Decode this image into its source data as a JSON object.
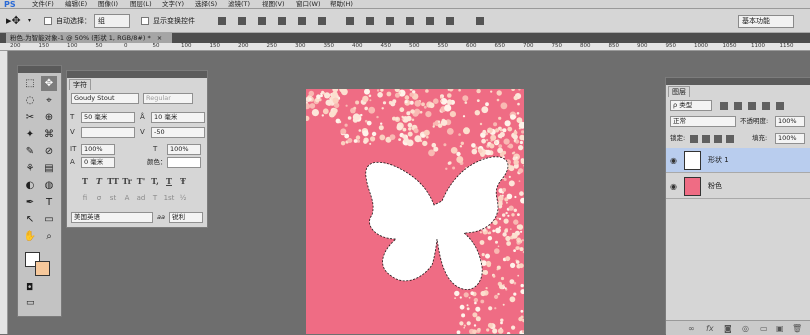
{
  "app": {
    "logo": "PS"
  },
  "menu": [
    "文件(F)",
    "编辑(E)",
    "图像(I)",
    "图层(L)",
    "文字(Y)",
    "选择(S)",
    "滤镜(T)",
    "视图(V)",
    "窗口(W)",
    "帮助(H)"
  ],
  "options": {
    "auto_select_label": "自动选择：",
    "auto_select_value": "组",
    "show_transform_label": "显示变换控件",
    "workspace": "基本功能"
  },
  "document": {
    "tab": "粉色.为智能对象-1 @ 50% (形状 1, RGB/8#) *",
    "close": "×"
  },
  "ruler": [
    "200",
    "150",
    "100",
    "50",
    "0",
    "50",
    "100",
    "150",
    "200",
    "250",
    "300",
    "350",
    "400",
    "450",
    "500",
    "550",
    "600",
    "650",
    "700",
    "750",
    "800",
    "850",
    "900",
    "950",
    "1000",
    "1050",
    "1100",
    "1150"
  ],
  "tools": {
    "icons": [
      "⬚",
      "✥",
      "◌",
      "⌖",
      "✂",
      "⊕",
      "✦",
      "⌘",
      "✎",
      "⊘",
      "⚘",
      "▤",
      "◐",
      "◍",
      "✒",
      "T",
      "↖",
      "▭",
      "✋",
      "⌕"
    ]
  },
  "character": {
    "tab": "字符",
    "font_family": "Goudy Stout",
    "font_style": "Regular",
    "size": "50 毫米",
    "leading": "10 毫米",
    "kerning": "",
    "tracking": "-50",
    "vscale": "100%",
    "hscale": "100%",
    "baseline": "0 毫米",
    "color_label": "颜色：",
    "format_buttons": [
      "T",
      "T",
      "TT",
      "Tr",
      "T'",
      "T,",
      "T",
      "Ŧ"
    ],
    "opentype_buttons": [
      "fi",
      "σ",
      "st",
      "A",
      "ad",
      "T",
      "1st",
      "½"
    ],
    "language": "美国英语",
    "aa_label": "aa",
    "antialias": "锐利"
  },
  "layers": {
    "tab": "图层",
    "filter": "ρ 类型",
    "blend": "正常",
    "opacity_label": "不透明度:",
    "opacity": "100%",
    "lock_label": "锁定:",
    "fill_label": "填充:",
    "fill": "100%",
    "items": [
      {
        "name": "形状 1",
        "selected": true
      },
      {
        "name": "粉色",
        "selected": false
      }
    ],
    "footer_icons": [
      "∞",
      "fx",
      "◙",
      "◎",
      "▭",
      "▣",
      "🗑"
    ]
  },
  "colors": {
    "accent_selection": "#b9cdee",
    "canvas_pink": "#f06f86",
    "bg_swatch": "#f6c89b"
  }
}
